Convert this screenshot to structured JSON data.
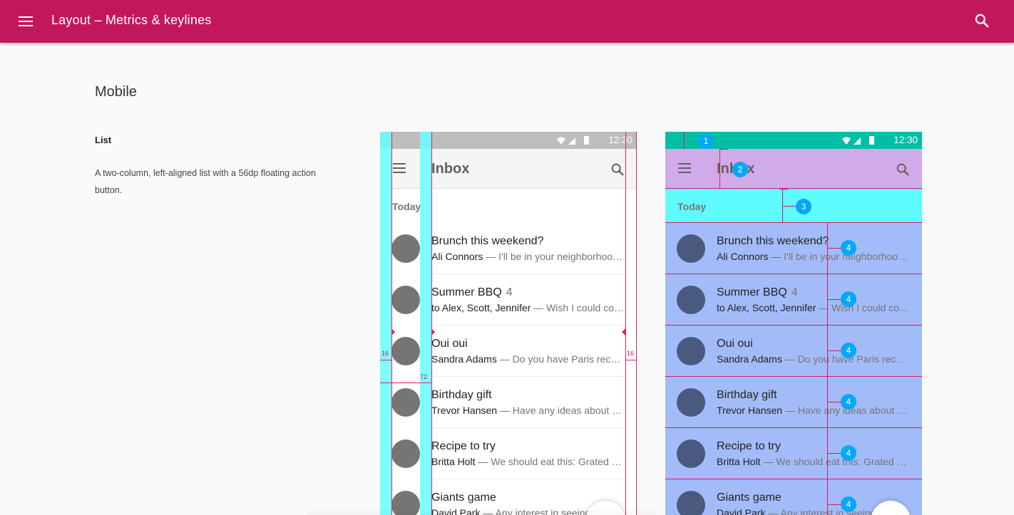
{
  "appbar": {
    "title": "Layout  –  Metrics & keylines",
    "menu_icon": "menu-icon",
    "search_icon": "search-icon"
  },
  "section": {
    "title": "Mobile",
    "subtitle": "List",
    "description": "A two-column, left-aligned list with a 56dp floating action button."
  },
  "colors": {
    "appbar": "#c2185b",
    "keyline_column": "#66ffff",
    "keyline_line": "#e91e63",
    "statusbar_spec": "#00bfa5",
    "toolbar_spec": "#d1aaea",
    "subheader_spec": "#5efbff",
    "list_spec": "#a3bcf9",
    "badge": "#03a9f4"
  },
  "phone": {
    "status_time": "12:30",
    "toolbar_title": "Inbox",
    "subheader": "Today",
    "rows": [
      {
        "title": "Brunch this weekend?",
        "count": "",
        "sender": "Ali Connors",
        "snippet": " — I'll be in your neighborhood doing errands"
      },
      {
        "title": "Summer BBQ",
        "count": "4",
        "sender": "to Alex, Scott, Jennifer",
        "snippet": " — Wish I could come, but I'm out of town"
      },
      {
        "title": "Oui oui",
        "count": "",
        "sender": "Sandra Adams",
        "snippet": " — Do you have Paris recommendations?"
      },
      {
        "title": "Birthday gift",
        "count": "",
        "sender": "Trevor Hansen",
        "snippet": " — Have any ideas about what we should get"
      },
      {
        "title": "Recipe to try",
        "count": "",
        "sender": "Britta Holt",
        "snippet": " — We should eat this: Grated squash, corn"
      },
      {
        "title": "Giants game",
        "count": "",
        "sender": "David Park",
        "snippet": " — Any interest in seeing the game"
      }
    ]
  },
  "keylines": {
    "left_margin": "16",
    "content_keyline": "72",
    "right_margin": "16"
  },
  "annotations": {
    "statusbar": "1",
    "toolbar": "2",
    "subheader": "3",
    "list_item": "4"
  }
}
